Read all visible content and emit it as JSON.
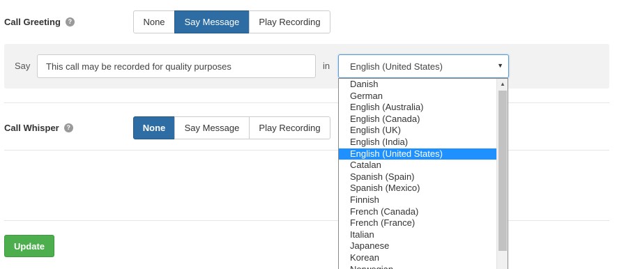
{
  "call_greeting": {
    "label": "Call Greeting",
    "help": "?",
    "options": [
      "None",
      "Say Message",
      "Play Recording"
    ],
    "selected": "Say Message"
  },
  "say_panel": {
    "say_label": "Say",
    "message_value": "This call may be recorded for quality purposes",
    "in_label": "in",
    "language_selected": "English (United States)",
    "caret": "▼"
  },
  "call_whisper": {
    "label": "Call Whisper",
    "help": "?",
    "options": [
      "None",
      "Say Message",
      "Play Recording"
    ],
    "selected": "None"
  },
  "update_label": "Update",
  "language_options": [
    "Danish",
    "German",
    "English (Australia)",
    "English (Canada)",
    "English (UK)",
    "English (India)",
    "English (United States)",
    "Catalan",
    "Spanish (Spain)",
    "Spanish (Mexico)",
    "Finnish",
    "French (Canada)",
    "French (France)",
    "Italian",
    "Japanese",
    "Korean",
    "Norwegian"
  ],
  "scroll_up_glyph": "▲",
  "colors": {
    "primary_active": "#2d6da3",
    "success": "#4cae4c",
    "highlight": "#1e90ff"
  }
}
